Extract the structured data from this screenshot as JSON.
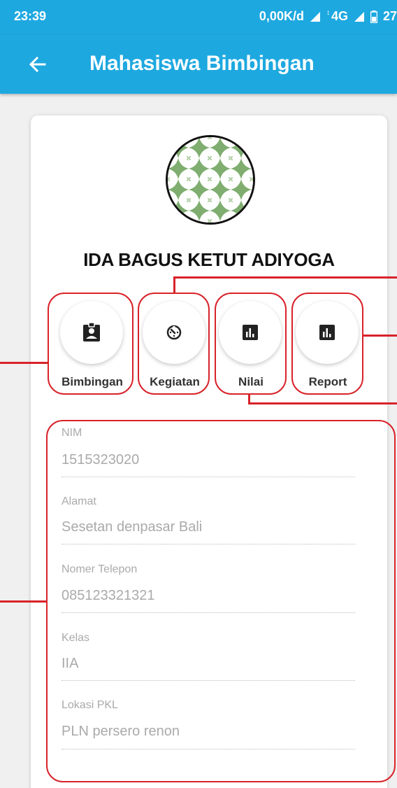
{
  "status_bar": {
    "time": "23:39",
    "speed": "0,00K/d",
    "network": "4G",
    "battery": "27"
  },
  "app_bar": {
    "title": "Mahasiswa Bimbingan",
    "back_icon": "arrow-left-icon"
  },
  "profile": {
    "name": "IDA BAGUS KETUT ADIYOGA"
  },
  "actions": [
    {
      "label": "Bimbingan",
      "icon": "contact-badge-icon"
    },
    {
      "label": "Kegiatan",
      "icon": "timer-icon"
    },
    {
      "label": "Nilai",
      "icon": "bar-chart-icon"
    },
    {
      "label": "Report",
      "icon": "bar-chart-icon"
    }
  ],
  "fields": [
    {
      "label": "NIM",
      "value": "1515323020"
    },
    {
      "label": "Alamat",
      "value": "Sesetan denpasar Bali"
    },
    {
      "label": "Nomer Telepon",
      "value": "085123321321"
    },
    {
      "label": "Kelas",
      "value": "IIA"
    },
    {
      "label": "Lokasi PKL",
      "value": "PLN persero renon"
    }
  ],
  "colors": {
    "primary": "#1ea8e0",
    "highlight": "#d8232a",
    "avatar_green": "#7fae70"
  }
}
